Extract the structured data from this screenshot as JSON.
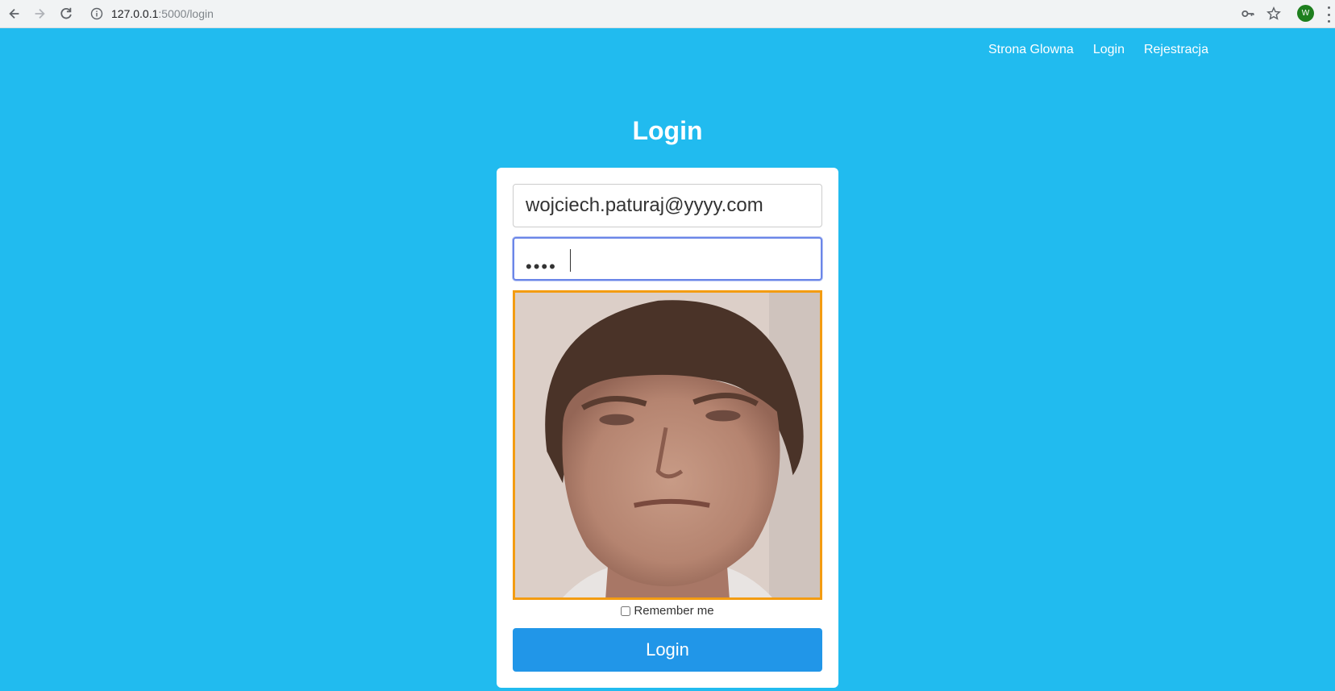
{
  "browser": {
    "url_host": "127.0.0.1",
    "url_path": ":5000/login",
    "avatar_letter": "W"
  },
  "nav": {
    "items": [
      {
        "label": "Strona Glowna"
      },
      {
        "label": "Login"
      },
      {
        "label": "Rejestracja"
      }
    ]
  },
  "page": {
    "title": "Login"
  },
  "form": {
    "email_value": "wojciech.paturaj@yyyy.com",
    "password_mask": "••••",
    "remember_label": "Remember me",
    "submit_label": "Login"
  },
  "colors": {
    "background": "#21bbef",
    "button": "#2196e8",
    "video_border": "#f39c12"
  }
}
